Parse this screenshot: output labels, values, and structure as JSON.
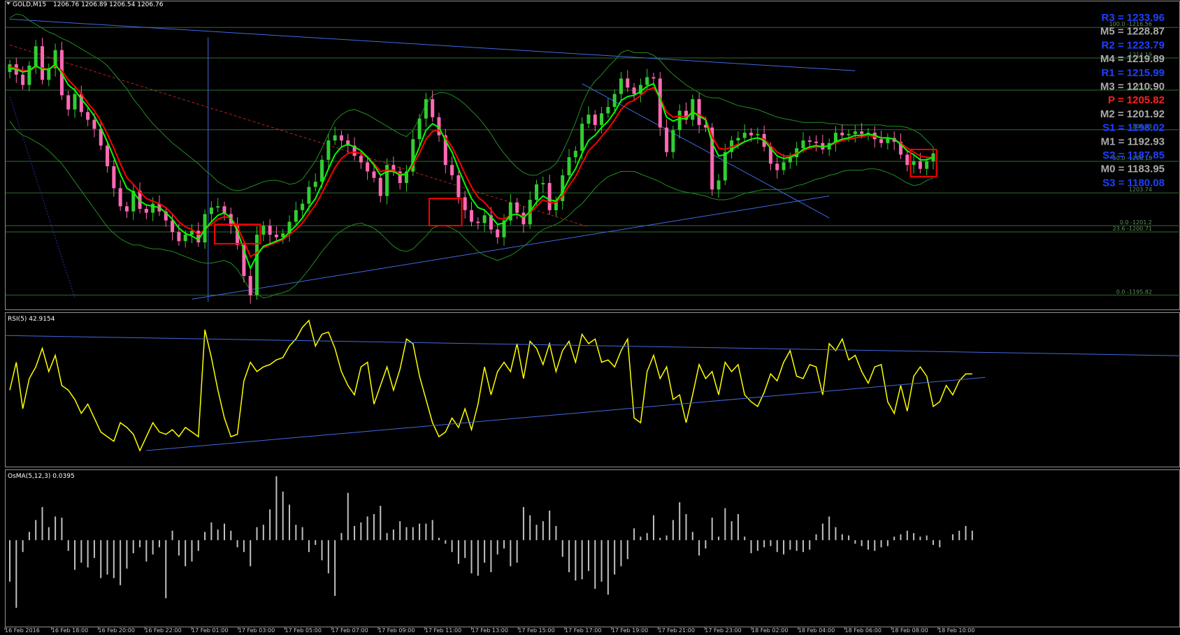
{
  "header": {
    "symbol": "GOLD,M15",
    "ohlc": "1206.76 1206.89 1206.54 1206.76"
  },
  "colors": {
    "background": "#000000",
    "bull": "#32CD32",
    "bear": "#FF69B4",
    "ma_fast": "#00FF00",
    "ma_slow": "#FF0000",
    "bollinger": "#228B22",
    "trendline": "#4169E1",
    "fib_line": "#2E6B2E",
    "rsi": "#FFFF00",
    "osma": "#C0C0C0",
    "highlight_box": "#FF0000"
  },
  "pivots": [
    {
      "label": "R3 = 1233.96",
      "color": "#1E40FF"
    },
    {
      "label": "M5 = 1228.87",
      "color": "#A9A9A9"
    },
    {
      "label": "R2 = 1223.79",
      "color": "#1E40FF"
    },
    {
      "label": "M4 = 1219.89",
      "color": "#A9A9A9"
    },
    {
      "label": "R1 = 1215.99",
      "color": "#1E40FF"
    },
    {
      "label": "M3 = 1210.90",
      "color": "#A9A9A9"
    },
    {
      "label": "P = 1205.82",
      "color": "#FF2020"
    },
    {
      "label": "M2 = 1201.92",
      "color": "#A9A9A9"
    },
    {
      "label": "S1 = 1198.02",
      "color": "#1E40FF"
    },
    {
      "label": "M1 = 1192.93",
      "color": "#A9A9A9"
    },
    {
      "label": "S2 = 1187.85",
      "color": "#1E40FF"
    },
    {
      "label": "M0 = 1183.95",
      "color": "#A9A9A9"
    },
    {
      "label": "S3 = 1180.08",
      "color": "#1E40FF"
    }
  ],
  "fib_levels": [
    "100.0 -1216.56",
    "1214.19",
    "1211.7",
    "1208.63",
    "50.0 -1206.18",
    "1203.74",
    "0.0 -1201.2",
    "23.6 -1200.71",
    "0.0 -1195.82"
  ],
  "rsi": {
    "label": "RSI(5) 42.9154"
  },
  "osma": {
    "label": "OsMA(5,12,3) 0.0395"
  },
  "time_labels": [
    "16 Feb 2016",
    "16 Feb 18:00",
    "16 Feb 20:00",
    "16 Feb 22:00",
    "17 Feb 01:00",
    "17 Feb 03:00",
    "17 Feb 05:00",
    "17 Feb 07:00",
    "17 Feb 09:00",
    "17 Feb 11:00",
    "17 Feb 13:00",
    "17 Feb 15:00",
    "17 Feb 17:00",
    "17 Feb 19:00",
    "17 Feb 21:00",
    "17 Feb 23:00",
    "18 Feb 02:00",
    "18 Feb 04:00",
    "18 Feb 06:00",
    "18 Feb 08:00",
    "18 Feb 10:00"
  ],
  "chart_data": {
    "type": "candlestick",
    "symbol": "GOLD",
    "timeframe": "M15",
    "price_range": [
      1195.3,
      1217.6
    ],
    "close": [
      1213.7,
      1212.9,
      1212.1,
      1213.6,
      1215.1,
      1212.5,
      1213.4,
      1214.8,
      1211.3,
      1210.2,
      1211.4,
      1210.0,
      1209.4,
      1208.7,
      1207.4,
      1205.8,
      1204.1,
      1202.7,
      1202.3,
      1203.9,
      1202.5,
      1202.2,
      1202.9,
      1202.3,
      1201.6,
      1200.7,
      1200.0,
      1200.5,
      1200.8,
      1199.9,
      1202.1,
      1202.6,
      1202.7,
      1202.1,
      1201.2,
      1199.7,
      1197.3,
      1195.8,
      1200.5,
      1201.2,
      1200.5,
      1200.3,
      1200.6,
      1201.5,
      1202.4,
      1202.9,
      1204.2,
      1204.6,
      1206.3,
      1207.8,
      1208.2,
      1207.8,
      1207.4,
      1206.6,
      1206.1,
      1205.4,
      1204.9,
      1203.5,
      1205.9,
      1205.4,
      1204.5,
      1205.4,
      1207.9,
      1209.5,
      1211.0,
      1209.6,
      1208.2,
      1205.9,
      1205.1,
      1203.4,
      1202.4,
      1201.5,
      1201.4,
      1202.0,
      1200.9,
      1200.3,
      1201.6,
      1203.0,
      1202.2,
      1201.3,
      1203.2,
      1204.4,
      1204.5,
      1202.4,
      1203.1,
      1205.1,
      1206.5,
      1207.0,
      1209.1,
      1209.8,
      1209.0,
      1209.9,
      1210.4,
      1211.4,
      1212.6,
      1211.9,
      1211.4,
      1212.1,
      1212.7,
      1212.6,
      1208.8,
      1206.9,
      1208.6,
      1210.1,
      1209.4,
      1211.0,
      1209.0,
      1208.8,
      1204.0,
      1204.7,
      1206.9,
      1207.8,
      1208.0,
      1208.4,
      1208.2,
      1208.3,
      1207.3,
      1206.0,
      1205.5,
      1206.1,
      1206.5,
      1207.2,
      1207.8,
      1207.7,
      1207.6,
      1207.1,
      1207.6,
      1208.4,
      1208.2,
      1208.3,
      1208.5,
      1208.3,
      1208.4,
      1207.9,
      1207.6,
      1208.0,
      1207.7,
      1206.7,
      1205.9,
      1206.2,
      1205.6,
      1206.2,
      1206.8
    ],
    "open": [
      1213.1,
      1213.7,
      1212.9,
      1212.1,
      1213.6,
      1215.1,
      1212.5,
      1213.4,
      1214.8,
      1211.3,
      1210.2,
      1211.4,
      1210.0,
      1209.4,
      1208.7,
      1207.4,
      1205.8,
      1204.1,
      1202.7,
      1202.3,
      1203.9,
      1202.5,
      1202.2,
      1202.9,
      1202.3,
      1201.6,
      1200.7,
      1200.0,
      1200.5,
      1200.8,
      1199.9,
      1202.1,
      1202.6,
      1202.7,
      1202.1,
      1201.2,
      1199.7,
      1197.3,
      1195.8,
      1200.5,
      1201.2,
      1200.5,
      1200.3,
      1200.6,
      1201.5,
      1202.4,
      1202.9,
      1204.2,
      1204.6,
      1206.3,
      1207.8,
      1208.2,
      1207.8,
      1207.4,
      1206.6,
      1206.1,
      1205.4,
      1204.9,
      1203.5,
      1205.9,
      1205.4,
      1204.5,
      1205.4,
      1207.9,
      1209.5,
      1211.0,
      1209.6,
      1208.2,
      1205.9,
      1205.1,
      1203.4,
      1202.4,
      1201.5,
      1201.4,
      1202.0,
      1200.9,
      1200.3,
      1201.6,
      1203.0,
      1202.2,
      1201.3,
      1203.2,
      1204.4,
      1204.5,
      1202.4,
      1203.1,
      1205.1,
      1206.5,
      1207.0,
      1209.1,
      1209.8,
      1209.0,
      1209.9,
      1210.4,
      1211.4,
      1212.6,
      1211.9,
      1211.4,
      1212.1,
      1212.7,
      1212.6,
      1208.8,
      1206.9,
      1208.6,
      1210.1,
      1209.4,
      1211.0,
      1209.0,
      1208.8,
      1204.0,
      1204.7,
      1206.9,
      1207.8,
      1208.0,
      1208.4,
      1208.2,
      1208.3,
      1207.3,
      1206.0,
      1205.5,
      1206.1,
      1206.5,
      1207.2,
      1207.8,
      1207.7,
      1207.6,
      1207.1,
      1207.6,
      1208.4,
      1208.2,
      1208.3,
      1208.5,
      1208.3,
      1208.4,
      1207.9,
      1207.6,
      1208.0,
      1207.7,
      1206.7,
      1205.9,
      1206.2,
      1205.6,
      1206.2
    ],
    "ma_fast": [
      1213.4,
      1213.3,
      1213.1,
      1213.2,
      1213.6,
      1213.3,
      1213.3,
      1213.7,
      1213.0,
      1212.1,
      1211.7,
      1211.0,
      1210.4,
      1209.7,
      1208.8,
      1207.7,
      1206.5,
      1205.2,
      1204.1,
      1203.8,
      1203.1,
      1202.8,
      1202.7,
      1202.6,
      1202.2,
      1201.7,
      1201.0,
      1200.6,
      1200.4,
      1200.1,
      1200.9,
      1201.5,
      1202.0,
      1202.2,
      1201.8,
      1200.8,
      1199.3,
      1197.9,
      1198.9,
      1199.6,
      1199.8,
      1200.0,
      1200.2,
      1200.7,
      1201.2,
      1201.8,
      1202.6,
      1203.3,
      1204.4,
      1205.6,
      1206.7,
      1207.3,
      1207.5,
      1207.3,
      1207.0,
      1206.5,
      1205.9,
      1205.1,
      1205.4,
      1205.4,
      1205.1,
      1205.2,
      1206.1,
      1207.3,
      1208.6,
      1209.1,
      1208.8,
      1207.8,
      1206.9,
      1205.6,
      1204.4,
      1203.3,
      1202.6,
      1202.4,
      1201.9,
      1201.3,
      1201.4,
      1202.0,
      1202.1,
      1201.8,
      1202.3,
      1203.0,
      1203.5,
      1203.2,
      1203.1,
      1203.8,
      1204.8,
      1205.6,
      1206.8,
      1207.8,
      1208.2,
      1208.8,
      1209.3,
      1210.0,
      1210.9,
      1211.2,
      1211.3,
      1211.6,
      1212.0,
      1212.2,
      1211.0,
      1209.6,
      1209.3,
      1209.5,
      1209.5,
      1210.0,
      1209.7,
      1209.4,
      1207.6,
      1206.6,
      1206.7,
      1207.1,
      1207.4,
      1207.7,
      1207.9,
      1208.0,
      1207.8,
      1207.2,
      1206.6,
      1206.4,
      1206.5,
      1206.7,
      1207.1,
      1207.3,
      1207.4,
      1207.3,
      1207.4,
      1207.7,
      1207.9,
      1208.0,
      1208.2,
      1208.2,
      1208.3,
      1208.2,
      1208.0,
      1208.0,
      1207.9,
      1207.5,
      1207.0,
      1206.7,
      1206.3,
      1206.3,
      1206.5
    ],
    "ma_slow": [
      1213.5,
      1213.4,
      1213.2,
      1213.2,
      1213.5,
      1213.4,
      1213.3,
      1213.6,
      1213.2,
      1212.5,
      1212.0,
      1211.4,
      1210.7,
      1210.1,
      1209.3,
      1208.3,
      1207.2,
      1206.0,
      1204.9,
      1204.4,
      1203.8,
      1203.3,
      1203.1,
      1202.9,
      1202.6,
      1202.1,
      1201.5,
      1201.1,
      1200.9,
      1200.5,
      1200.9,
      1201.3,
      1201.7,
      1201.9,
      1201.8,
      1201.1,
      1200.0,
      1198.8,
      1199.1,
      1199.5,
      1199.7,
      1199.9,
      1200.1,
      1200.5,
      1200.9,
      1201.4,
      1202.1,
      1202.8,
      1203.7,
      1204.7,
      1205.7,
      1206.4,
      1206.8,
      1206.9,
      1206.8,
      1206.5,
      1206.0,
      1205.4,
      1205.5,
      1205.5,
      1205.2,
      1205.2,
      1205.9,
      1206.8,
      1207.9,
      1208.5,
      1208.6,
      1208.0,
      1207.3,
      1206.3,
      1205.2,
      1204.2,
      1203.4,
      1203.0,
      1202.4,
      1201.8,
      1201.7,
      1202.0,
      1202.1,
      1201.9,
      1202.2,
      1202.7,
      1203.2,
      1203.0,
      1203.0,
      1203.5,
      1204.3,
      1205.0,
      1206.0,
      1207.0,
      1207.5,
      1208.1,
      1208.7,
      1209.4,
      1210.2,
      1210.7,
      1210.9,
      1211.3,
      1211.7,
      1211.9,
      1211.1,
      1210.0,
      1209.6,
      1209.7,
      1209.6,
      1210.0,
      1209.8,
      1209.5,
      1208.1,
      1207.2,
      1207.1,
      1207.3,
      1207.5,
      1207.7,
      1207.9,
      1208.0,
      1207.9,
      1207.4,
      1206.9,
      1206.6,
      1206.6,
      1206.8,
      1207.0,
      1207.2,
      1207.3,
      1207.3,
      1207.4,
      1207.6,
      1207.8,
      1207.9,
      1208.0,
      1208.1,
      1208.2,
      1208.1,
      1208.0,
      1208.0,
      1207.9,
      1207.6,
      1207.2,
      1206.9,
      1206.6,
      1206.5,
      1206.5
    ],
    "bb_upper": [
      1217.3,
      1217.6,
      1217.5,
      1217.1,
      1216.8,
      1216.5,
      1216.2,
      1216.0,
      1215.7,
      1215.5,
      1215.2,
      1214.9,
      1214.6,
      1214.3,
      1214.0,
      1213.6,
      1213.0,
      1212.4,
      1211.8,
      1211.0,
      1210.4,
      1209.7,
      1209.1,
      1208.6,
      1208.1,
      1207.6,
      1207.2,
      1206.8,
      1206.4,
      1206.0,
      1205.5,
      1205.1,
      1204.6,
      1204.3,
      1204.0,
      1203.9,
      1204.0,
      1204.2,
      1204.4,
      1204.6,
      1204.7,
      1204.7,
      1204.6,
      1204.4,
      1204.5,
      1204.8,
      1205.5,
      1206.2,
      1207.2,
      1208.3,
      1209.3,
      1209.8,
      1210.1,
      1210.2,
      1210.0,
      1209.8,
      1209.5,
      1209.2,
      1208.9,
      1208.6,
      1208.3,
      1208.1,
      1208.6,
      1209.5,
      1210.6,
      1211.3,
      1211.5,
      1211.5,
      1211.3,
      1211.0,
      1210.6,
      1210.1,
      1209.6,
      1209.0,
      1208.3,
      1207.5,
      1206.8,
      1206.2,
      1205.7,
      1205.3,
      1205.1,
      1205.1,
      1205.4,
      1205.6,
      1206.0,
      1206.9,
      1208.0,
      1209.2,
      1210.6,
      1211.7,
      1212.4,
      1212.9,
      1213.5,
      1214.0,
      1214.6,
      1214.8,
      1214.6,
      1214.6,
      1214.6,
      1214.4,
      1214.0,
      1213.4,
      1212.9,
      1212.5,
      1212.1,
      1211.8,
      1211.5,
      1211.2,
      1211.1,
      1211.1,
      1210.9,
      1210.7,
      1210.5,
      1210.4,
      1210.3,
      1210.2,
      1210.0,
      1209.8,
      1209.6,
      1209.5,
      1209.4,
      1209.3,
      1209.2,
      1209.2,
      1209.2,
      1209.2,
      1209.1,
      1209.1,
      1209.0,
      1209.0,
      1209.0,
      1209.0,
      1209.0,
      1209.0,
      1209.0,
      1208.9,
      1208.9,
      1208.9,
      1208.8,
      1208.6,
      1208.3,
      1207.8,
      1207.3
    ],
    "bb_lower": [
      1209.3,
      1208.6,
      1208.2,
      1208.0,
      1207.7,
      1207.4,
      1207.0,
      1206.5,
      1206.0,
      1205.3,
      1204.6,
      1203.9,
      1203.2,
      1202.5,
      1201.8,
      1201.1,
      1200.6,
      1200.2,
      1199.9,
      1199.7,
      1199.7,
      1199.5,
      1199.4,
      1199.4,
      1199.3,
      1199.2,
      1199.0,
      1198.8,
      1198.6,
      1198.4,
      1198.3,
      1198.3,
      1198.4,
      1198.5,
      1198.3,
      1197.8,
      1197.0,
      1196.2,
      1195.9,
      1195.6,
      1195.7,
      1195.9,
      1196.0,
      1196.2,
      1196.6,
      1197.2,
      1197.8,
      1198.5,
      1199.2,
      1199.8,
      1200.4,
      1200.8,
      1201.1,
      1201.3,
      1201.4,
      1201.2,
      1201.0,
      1200.6,
      1200.1,
      1199.6,
      1199.3,
      1199.2,
      1199.4,
      1199.9,
      1200.4,
      1201.0,
      1201.2,
      1201.2,
      1201.0,
      1200.7,
      1200.2,
      1199.7,
      1199.2,
      1198.9,
      1198.7,
      1198.5,
      1198.7,
      1198.9,
      1199.2,
      1199.6,
      1200.0,
      1200.5,
      1200.9,
      1201.1,
      1201.3,
      1201.6,
      1202.0,
      1202.5,
      1202.9,
      1203.5,
      1204.1,
      1204.6,
      1205.0,
      1205.2,
      1205.4,
      1205.4,
      1205.4,
      1205.2,
      1205.0,
      1204.8,
      1204.6,
      1204.3,
      1204.1,
      1203.9,
      1203.8,
      1203.7,
      1203.6,
      1203.5,
      1203.3,
      1203.2,
      1203.2,
      1203.3,
      1203.5,
      1203.7,
      1203.8,
      1203.9,
      1204.0,
      1204.0,
      1204.0,
      1204.0,
      1204.1,
      1204.3,
      1204.4,
      1204.6,
      1204.8,
      1204.9,
      1205.1,
      1205.2,
      1205.4,
      1205.5,
      1205.5,
      1205.5,
      1205.6,
      1205.6,
      1205.5,
      1205.3,
      1205.1,
      1204.8,
      1204.5,
      1204.3,
      1204.4,
      1204.7,
      1204.9
    ],
    "rsi_range": [
      18,
      82
    ],
    "rsi": [
      50,
      62,
      42,
      55,
      60,
      68,
      58,
      65,
      52,
      50,
      46,
      40,
      44,
      38,
      32,
      30,
      28,
      36,
      34,
      31,
      24,
      30,
      36,
      32,
      31,
      33,
      30,
      34,
      32,
      30,
      76,
      64,
      50,
      38,
      30,
      31,
      54,
      62,
      58,
      60,
      61,
      63,
      64,
      69,
      72,
      77,
      80,
      69,
      74,
      75,
      68,
      58,
      52,
      48,
      60,
      62,
      44,
      52,
      60,
      50,
      59,
      72,
      70,
      56,
      46,
      36,
      30,
      32,
      38,
      34,
      42,
      33,
      44,
      60,
      48,
      58,
      62,
      58,
      70,
      55,
      71,
      68,
      61,
      70,
      58,
      67,
      71,
      62,
      74,
      70,
      72,
      62,
      63,
      60,
      67,
      72,
      38,
      36,
      58,
      65,
      55,
      60,
      46,
      48,
      36,
      48,
      61,
      55,
      58,
      48,
      62,
      58,
      61,
      48,
      45,
      43,
      49,
      57,
      54,
      62,
      67,
      56,
      55,
      61,
      60,
      48,
      70,
      67,
      72,
      63,
      65,
      58,
      53,
      60,
      61,
      45,
      40,
      52,
      41,
      56,
      60,
      56,
      43,
      45,
      52,
      48,
      54,
      57,
      57
    ],
    "osma_range": [
      -0.7,
      0.55
    ],
    "osma": [
      -0.35,
      -0.57,
      -0.1,
      0.07,
      0.17,
      0.28,
      0.11,
      0.2,
      0.19,
      -0.09,
      -0.25,
      -0.19,
      -0.23,
      -0.15,
      -0.32,
      -0.29,
      -0.32,
      -0.38,
      -0.24,
      -0.11,
      -0.06,
      -0.18,
      -0.12,
      -0.06,
      -0.49,
      0.08,
      -0.13,
      -0.22,
      -0.18,
      -0.09,
      0.07,
      0.15,
      0.09,
      0.14,
      0.08,
      -0.06,
      -0.1,
      -0.22,
      0.11,
      0.13,
      0.26,
      0.54,
      0.41,
      0.3,
      0.13,
      0.11,
      -0.1,
      -0.04,
      -0.17,
      -0.28,
      -0.47,
      0.06,
      0.4,
      0.12,
      0.15,
      0.2,
      0.22,
      0.29,
      0.06,
      0.09,
      0.16,
      0.11,
      0.11,
      0.14,
      0.14,
      0.17,
      0.02,
      -0.03,
      -0.1,
      -0.2,
      -0.15,
      -0.28,
      -0.3,
      -0.19,
      -0.27,
      -0.12,
      -0.07,
      -0.22,
      -0.19,
      0.28,
      0.21,
      0.13,
      0.16,
      0.25,
      0.12,
      -0.14,
      -0.27,
      -0.34,
      -0.33,
      -0.26,
      -0.41,
      -0.35,
      -0.46,
      -0.29,
      -0.22,
      -0.16,
      0.1,
      0.03,
      0.06,
      0.21,
      0.02,
      0.04,
      0.17,
      0.32,
      0.22,
      0.07,
      -0.13,
      -0.07,
      0.19,
      0.03,
      0.27,
      0.16,
      0.22,
      0.03,
      -0.11,
      -0.09,
      -0.06,
      -0.05,
      -0.1,
      -0.12,
      -0.08,
      -0.09,
      -0.1,
      -0.08,
      0.05,
      0.14,
      0.2,
      0.11,
      0.05,
      0.04,
      -0.03,
      -0.05,
      -0.08,
      -0.09,
      -0.06,
      -0.05,
      0.03,
      0.05,
      0.08,
      0.06,
      0.03,
      0.04,
      -0.04,
      -0.06,
      0.0,
      0.05,
      0.08,
      0.12,
      0.08
    ]
  }
}
